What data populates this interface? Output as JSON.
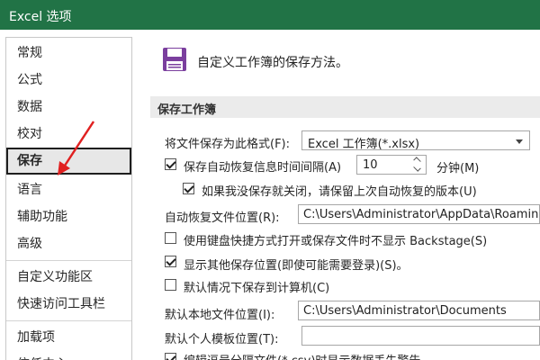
{
  "window": {
    "title": "Excel 选项"
  },
  "sidebar": {
    "items": [
      {
        "label": "常规"
      },
      {
        "label": "公式"
      },
      {
        "label": "数据"
      },
      {
        "label": "校对"
      },
      {
        "label": "保存"
      },
      {
        "label": "语言"
      },
      {
        "label": "辅助功能"
      },
      {
        "label": "高级"
      },
      {
        "label": "自定义功能区"
      },
      {
        "label": "快速访问工具栏"
      },
      {
        "label": "加载项"
      },
      {
        "label": "信任中心"
      }
    ],
    "selected": "保存"
  },
  "main": {
    "header": {
      "icon": "floppy-disk-icon",
      "text": "自定义工作簿的保存方法。"
    },
    "section_title": "保存工作簿",
    "format": {
      "label": "将文件保存为此格式(F):",
      "value": "Excel 工作簿(*.xlsx)"
    },
    "autorecover": {
      "label": "保存自动恢复信息时间间隔(A)",
      "checked": true,
      "value": "10",
      "unit": "分钟(M)"
    },
    "keep_last": {
      "label": "如果我没保存就关闭，请保留上次自动恢复的版本(U)",
      "checked": true
    },
    "autorecover_location": {
      "label": "自动恢复文件位置(R):",
      "value": "C:\\Users\\Administrator\\AppData\\Roaming"
    },
    "no_backstage": {
      "label": "使用键盘快捷方式打开或保存文件时不显示 Backstage(S)",
      "checked": false
    },
    "show_other_locations": {
      "label": "显示其他保存位置(即使可能需要登录)(S)。",
      "checked": true
    },
    "save_to_computer": {
      "label": "默认情况下保存到计算机(C)",
      "checked": false
    },
    "local_file_location": {
      "label": "默认本地文件位置(I):",
      "value": "C:\\Users\\Administrator\\Documents"
    },
    "template_location": {
      "label": "默认个人模板位置(T):",
      "value": ""
    },
    "csv_warning": {
      "label": "编辑逗号分隔文件(*.csv)时显示数据丢失警告"
    }
  },
  "colors": {
    "titlebar": "#217346",
    "arrow": "#e02020",
    "selected_bg": "#e7e7e7"
  }
}
